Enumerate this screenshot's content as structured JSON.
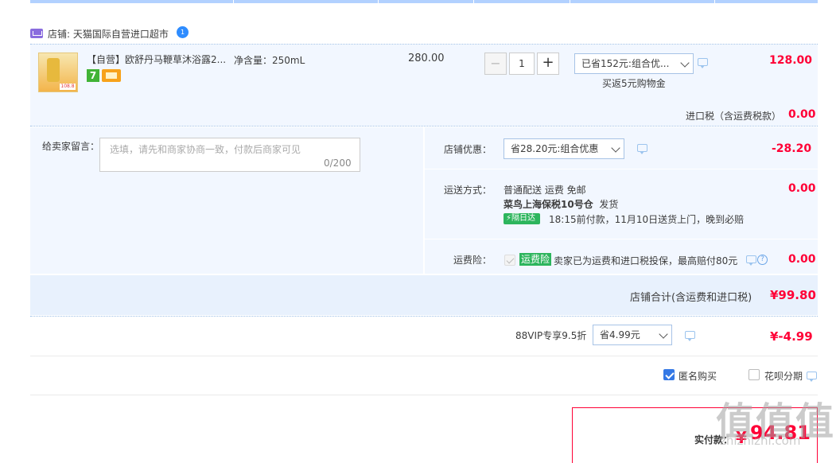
{
  "store": {
    "label": "店铺: 天猫国际自营进口超市",
    "badge": "1"
  },
  "item": {
    "title": "【自营】欧舒丹马鞭草沐浴露2...",
    "thumb_price": "108.8",
    "badge_seven": "7",
    "spec": "净含量：250mL",
    "unit_price": "280.00",
    "quantity": "1",
    "minus": "−",
    "plus": "+",
    "promo_select": "已省152元:组合优...",
    "rebate": "买返5元购物金",
    "subtotal": "128.00"
  },
  "import_tax": {
    "label": "进口税（含运费税款）",
    "value": "0.00"
  },
  "memo": {
    "label": "给卖家留言：",
    "placeholder": "选填，请先和商家协商一致，付款后商家可见",
    "count": "0/200"
  },
  "store_discount": {
    "label": "店铺优惠：",
    "select": "省28.20元:组合优惠",
    "value": "-28.20"
  },
  "shipping": {
    "label": "运送方式：",
    "method": "普通配送 运费 免邮",
    "warehouse": "菜鸟上海保税10号仓",
    "ship_suffix": "发货",
    "fast_tag": "隔日达",
    "eta": "18:15前付款，11月10日送货上门，晚到必赔",
    "value": "0.00"
  },
  "insurance": {
    "label": "运费险：",
    "tag": "运费险",
    "desc": "卖家已为运费和进口税投保，最高赔付80元",
    "help": "?",
    "value": "0.00"
  },
  "store_total": {
    "label": "店铺合计(含运费和进口税)",
    "value": "¥99.80"
  },
  "vip": {
    "label": "88VIP专享9.5折",
    "select": "省4.99元",
    "value": "¥-4.99"
  },
  "options": {
    "anonymous": "匿名购买",
    "installment": "花呗分期"
  },
  "payment": {
    "label": "实付款：",
    "currency": "¥",
    "value": "94.81"
  },
  "watermark": {
    "text": "值值值",
    "url": "zhizhizhi.com"
  },
  "colors": {
    "accent_red": "#ff0036",
    "panel_bg": "#f2f7ff",
    "green": "#2db55d",
    "checkbox_blue": "#3478e5"
  }
}
